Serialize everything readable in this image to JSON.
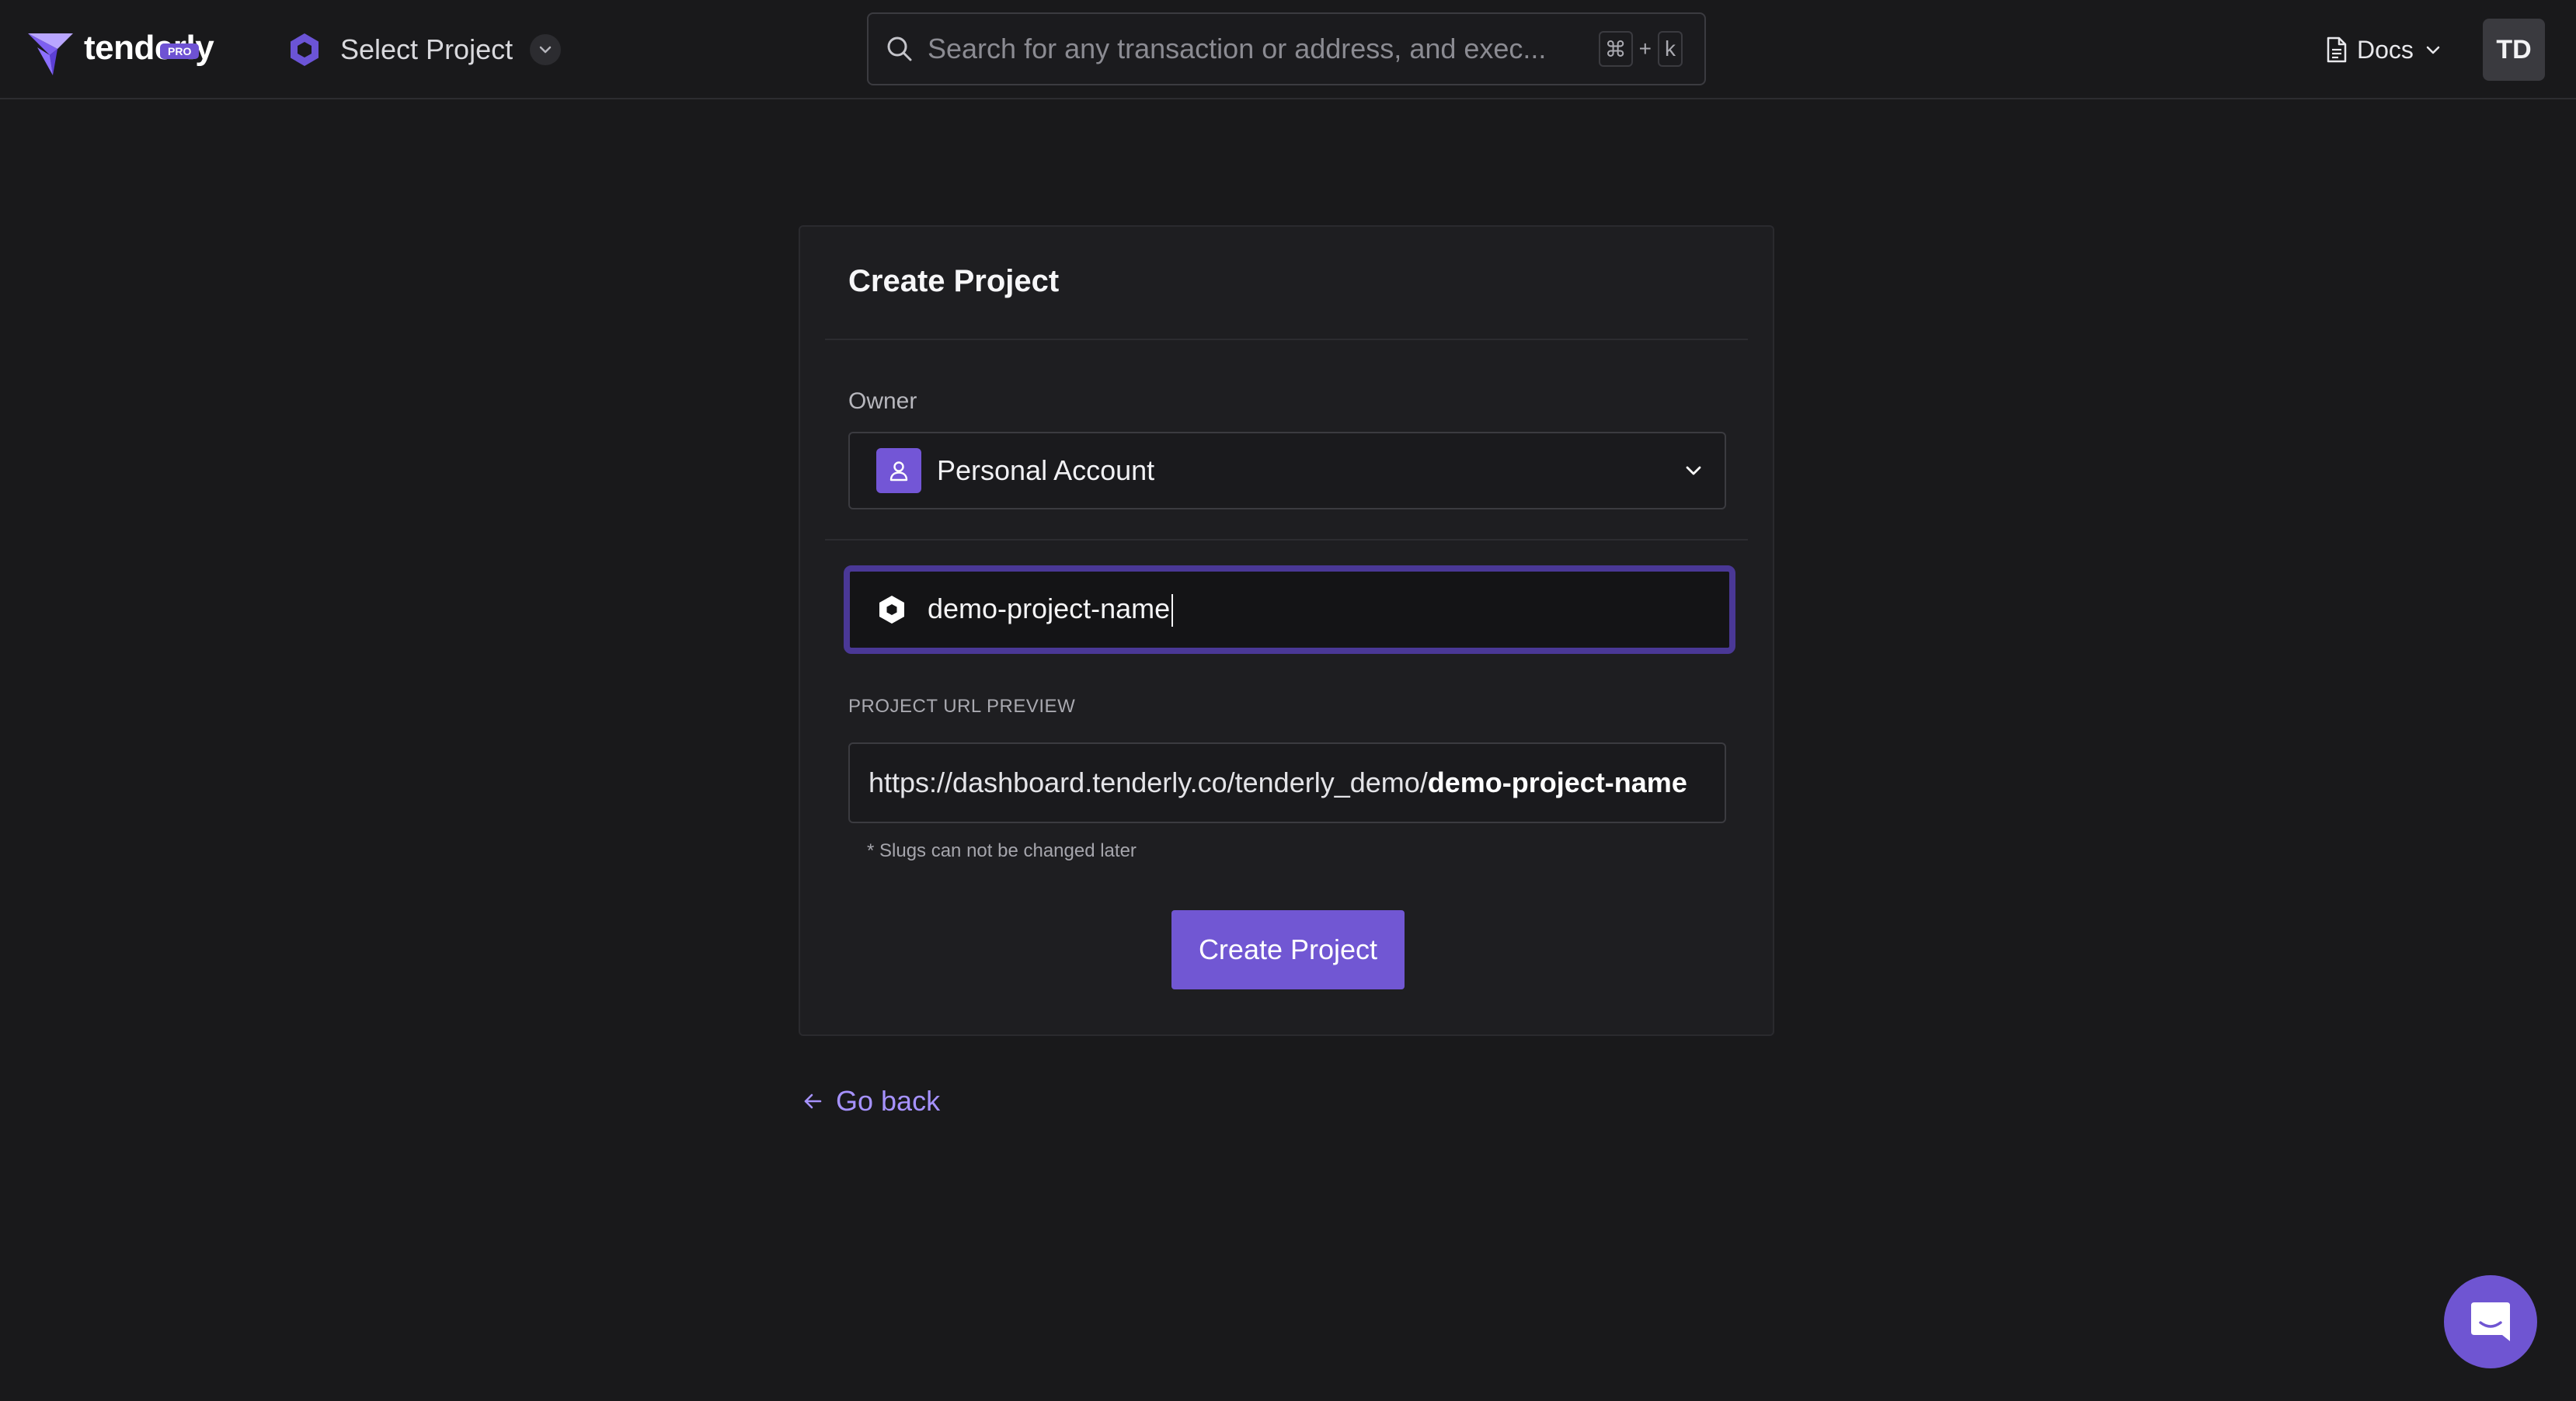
{
  "header": {
    "logo_text": "tenderly",
    "plan_badge": "PRO",
    "project_select_label": "Select Project",
    "search_placeholder": "Search for any transaction or address, and exec...",
    "shortcut_keys": [
      "⌘",
      "+",
      "k"
    ],
    "docs_label": "Docs",
    "avatar_initials": "TD"
  },
  "card": {
    "title": "Create Project",
    "owner_label": "Owner",
    "owner_value": "Personal Account",
    "project_name_value": "demo-project-name",
    "url_preview_label": "PROJECT URL PREVIEW",
    "url_base": "https://dashboard.tenderly.co/tenderly_demo/",
    "url_slug": "demo-project-name",
    "slug_note": "* Slugs can not be changed later",
    "create_button_label": "Create Project"
  },
  "go_back_label": "Go back",
  "colors": {
    "background": "#19191b",
    "card": "#1e1e21",
    "accent": "#7157d3",
    "focus_border": "#4a3896",
    "link": "#a692ff"
  },
  "icons": {
    "logo": "tenderly-logo-icon",
    "project": "hexagon-icon",
    "search": "search-icon",
    "docs": "document-icon",
    "owner": "user-icon",
    "go_back": "arrow-left-icon",
    "chat": "chat-icon"
  }
}
